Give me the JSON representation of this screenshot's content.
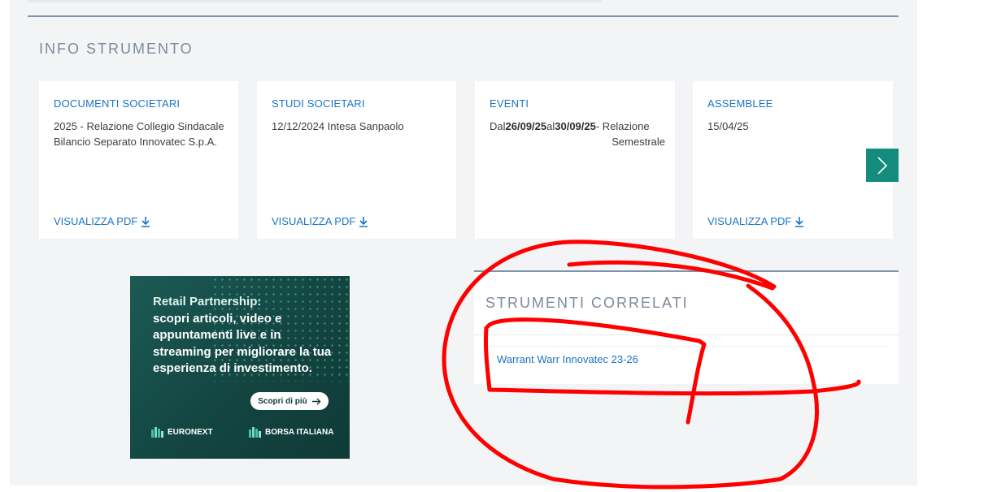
{
  "info_strumento": {
    "title": "INFO STRUMENTO",
    "cards": [
      {
        "heading": "DOCUMENTI SOCIETARI",
        "body": "2025 - Relazione Collegio Sindacale Bilancio Separato Innovatec S.p.A.",
        "link": "VISUALIZZA PDF"
      },
      {
        "heading": "STUDI SOCIETARI",
        "body": "12/12/2024 Intesa Sanpaolo",
        "link": "VISUALIZZA PDF"
      },
      {
        "heading": "EVENTI",
        "prefix": "Dal",
        "date_from": "26/09/25",
        "mid": "al",
        "date_to": "30/09/25",
        "suffix": "- Relazione",
        "line2": "Semestrale"
      },
      {
        "heading": "ASSEMBLEE",
        "body": "15/04/25",
        "link": "VISUALIZZA PDF"
      }
    ],
    "next_icon": "chevron-right-icon"
  },
  "ad": {
    "lead": "Retail Partnership:",
    "text": "scopri articoli, video e appuntamenti live e in streaming per migliorare la tua esperienza di investimento.",
    "cta": "Scopri di più",
    "logo1": "EURONEXT",
    "logo2": "BORSA ITALIANA"
  },
  "strumenti_correlati": {
    "title": "STRUMENTI CORRELATI",
    "items": [
      {
        "label": "Warrant Warr Innovatec 23-26"
      }
    ]
  },
  "colors": {
    "accent_link": "#1a74c4",
    "teal_button": "#138c7e",
    "annotation": "#ff0000"
  }
}
